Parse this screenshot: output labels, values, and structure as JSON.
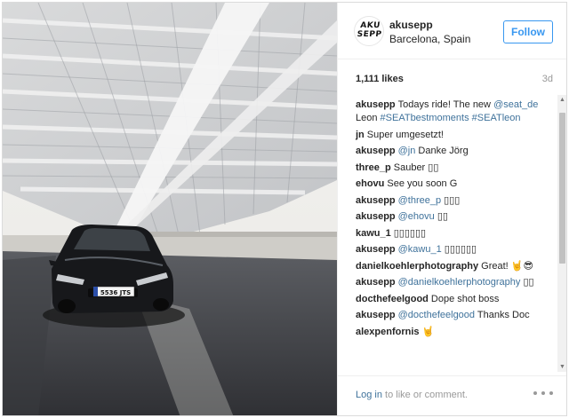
{
  "post": {
    "avatar_text": "AKU SEPP",
    "username": "akusepp",
    "location": "Barcelona, Spain",
    "follow_label": "Follow",
    "likes": "1,111 likes",
    "age": "3d",
    "photo_plate": "5536 JTS"
  },
  "comments": [
    {
      "user": "akusepp",
      "parts": [
        {
          "t": "Todays ride! The new ",
          "m": false
        },
        {
          "t": "@seat_de",
          "m": true
        },
        {
          "t": " Leon ",
          "m": false
        },
        {
          "t": "#SEATbestmoments",
          "m": true
        },
        {
          "t": " ",
          "m": false
        },
        {
          "t": "#SEATleon",
          "m": true
        }
      ]
    },
    {
      "user": "jn",
      "parts": [
        {
          "t": "Super umgesetzt!",
          "m": false
        }
      ]
    },
    {
      "user": "akusepp",
      "parts": [
        {
          "t": "@jn",
          "m": true
        },
        {
          "t": " Danke Jörg",
          "m": false
        }
      ]
    },
    {
      "user": "three_p",
      "parts": [
        {
          "t": "Sauber ▯▯",
          "m": false
        }
      ]
    },
    {
      "user": "ehovu",
      "parts": [
        {
          "t": "See you soon G",
          "m": false
        }
      ]
    },
    {
      "user": "akusepp",
      "parts": [
        {
          "t": "@three_p",
          "m": true
        },
        {
          "t": " ▯▯▯",
          "m": false
        }
      ]
    },
    {
      "user": "akusepp",
      "parts": [
        {
          "t": "@ehovu",
          "m": true
        },
        {
          "t": " ▯▯",
          "m": false
        }
      ]
    },
    {
      "user": "kawu_1",
      "parts": [
        {
          "t": "▯▯▯▯▯▯",
          "m": false
        }
      ]
    },
    {
      "user": "akusepp",
      "parts": [
        {
          "t": "@kawu_1",
          "m": true
        },
        {
          "t": " ▯▯▯▯▯▯",
          "m": false
        }
      ]
    },
    {
      "user": "danielkoehlerphotography",
      "parts": [
        {
          "t": "Great! 🤘😎",
          "m": false
        }
      ]
    },
    {
      "user": "akusepp",
      "parts": [
        {
          "t": "@danielkoehlerphotography",
          "m": true
        },
        {
          "t": " ▯▯",
          "m": false
        }
      ]
    },
    {
      "user": "docthefeelgood",
      "parts": [
        {
          "t": "Dope shot boss",
          "m": false
        }
      ]
    },
    {
      "user": "akusepp",
      "parts": [
        {
          "t": "@docthefeelgood",
          "m": true
        },
        {
          "t": " Thanks Doc",
          "m": false
        }
      ]
    },
    {
      "user": "alexpenfornis",
      "parts": [
        {
          "t": "🤘",
          "m": false
        }
      ]
    }
  ],
  "footer": {
    "login_link": "Log in",
    "login_rest": " to like or comment."
  },
  "icons": {
    "more": "more-options-icon",
    "scroll_up": "scroll-up-arrow-icon",
    "scroll_down": "scroll-down-arrow-icon"
  },
  "colors": {
    "accent": "#3897f0",
    "mention": "#3f729b",
    "muted": "#999999",
    "border": "#efefef"
  }
}
